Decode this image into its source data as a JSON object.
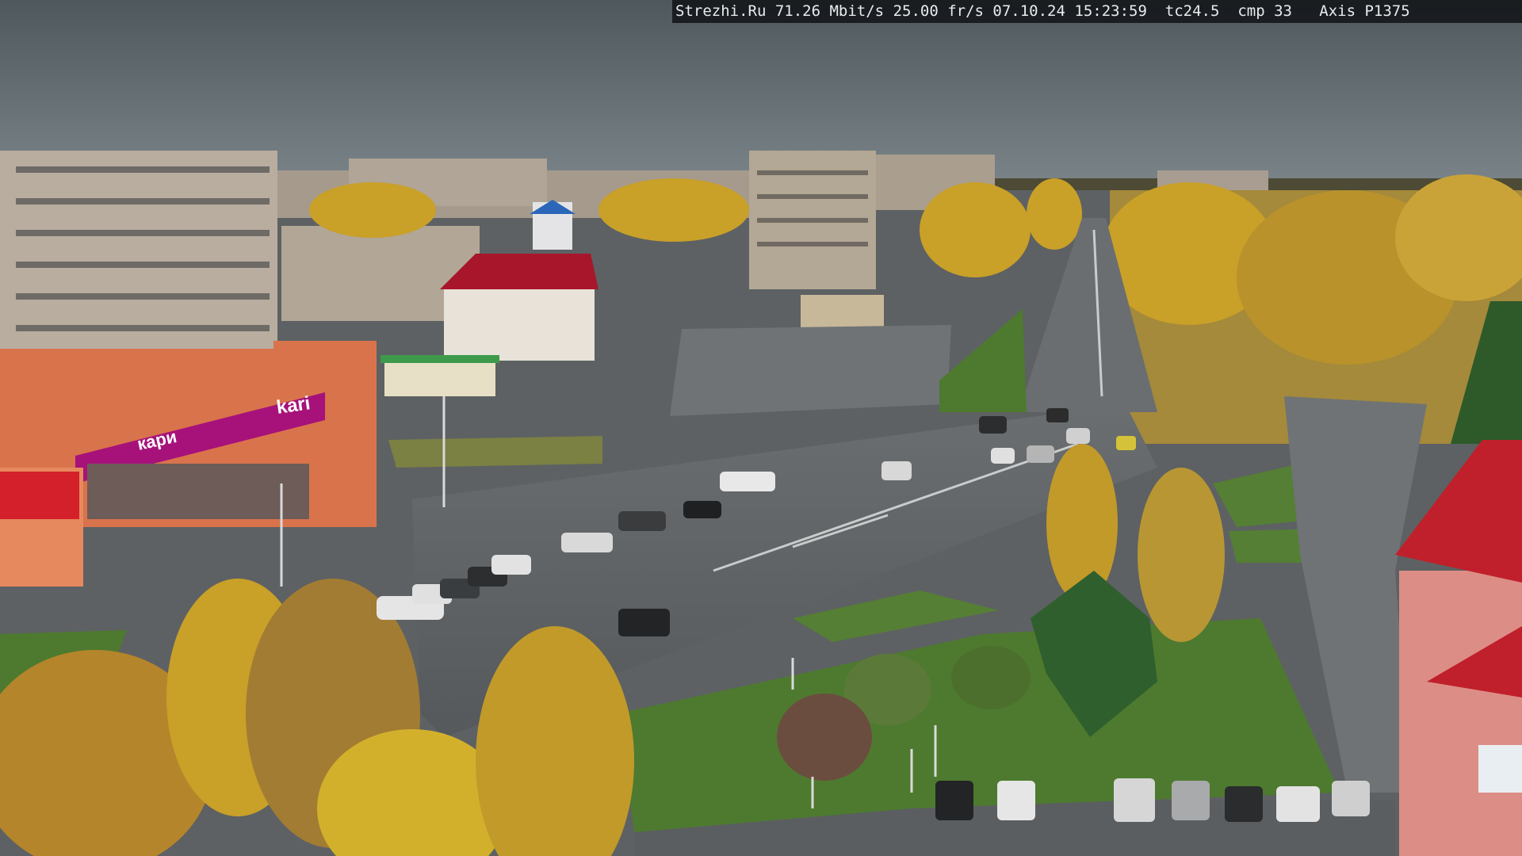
{
  "overlay": {
    "site": "Strezhi.Ru",
    "bitrate": "71.26 Mbit/s",
    "fps": "25.00 fr/s",
    "date": "07.10.24",
    "time": "15:23:59",
    "tc": "tc24.5",
    "cmp": "cmp 33",
    "camera": "Axis P1375"
  },
  "signs": {
    "store_main": "kari",
    "store_banner": "кари"
  },
  "colors": {
    "sky": "#5b6469",
    "asphalt": "#5d6163",
    "grass": "#4e7a2f",
    "foliage_yellow": "#c9a028",
    "store_magenta": "#a6127a",
    "store_orange": "#d9734c",
    "roof_red": "#b4162a",
    "osd_bg": "#121418",
    "osd_text": "#e8ecef"
  }
}
